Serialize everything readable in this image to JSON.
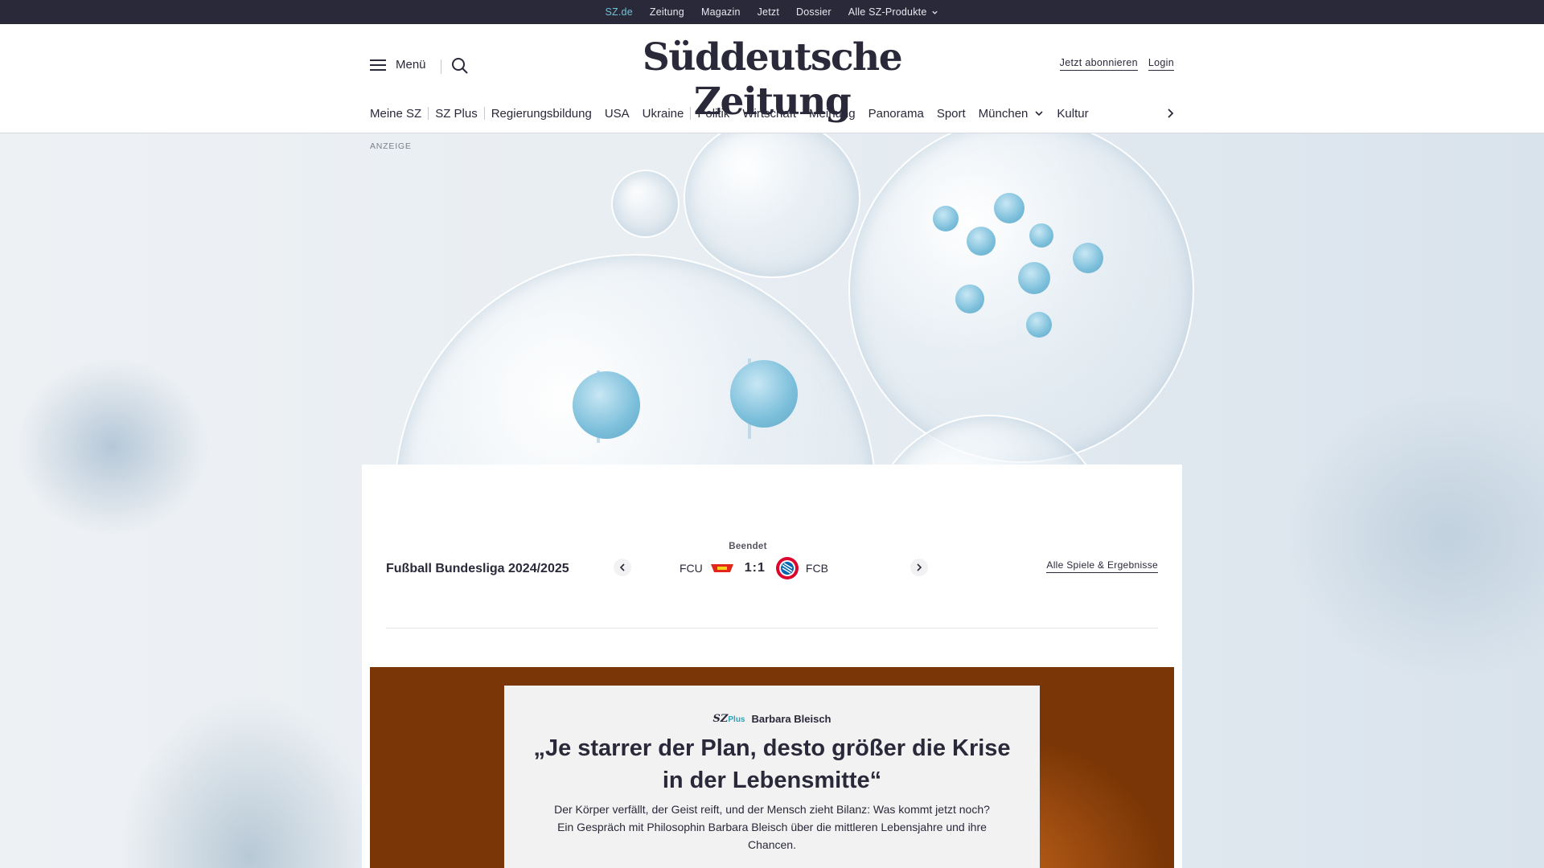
{
  "topbar": {
    "items": [
      {
        "label": "SZ.de",
        "active": true
      },
      {
        "label": "Zeitung"
      },
      {
        "label": "Magazin"
      },
      {
        "label": "Jetzt"
      },
      {
        "label": "Dossier"
      },
      {
        "label": "Alle SZ-Produkte",
        "dropdown": true
      }
    ]
  },
  "header": {
    "menu_label": "Menü",
    "logo": "Süddeutsche Zeitung",
    "subscribe": "Jetzt abonnieren",
    "login": "Login"
  },
  "nav": {
    "items": [
      "Meine SZ",
      "SZ Plus",
      "Regierungsbildung",
      "USA",
      "Ukraine",
      "Politik",
      "Wirtschaft",
      "Meinung",
      "Panorama",
      "Sport",
      "München",
      "Kultur"
    ]
  },
  "ad": {
    "label": "ANZEIGE"
  },
  "scores": {
    "league": "Fußball Bundesliga 2024/2025",
    "status": "Beendet",
    "home": "FCU",
    "away": "FCB",
    "score": "1:1",
    "all_games": "Alle Spiele & Ergebnisse"
  },
  "teaser": {
    "brand": "SZ",
    "brand_plus": "Plus",
    "author": "Barbara Bleisch",
    "headline": "„Je starrer der Plan, desto größer die Krise in der Lebensmitte“",
    "text": "Der Körper verfällt, der Geist reift, und der Mensch zieht Bilanz: Was kommt jetzt noch? Ein Gespräch mit Philosophin Barbara Bleisch über die mittleren Lebensjahre und ihre Chancen."
  },
  "colors": {
    "topbar_bg": "#29293a",
    "accent": "#71c1d4",
    "text": "#29293a",
    "szplus": "#2aa3b8"
  }
}
